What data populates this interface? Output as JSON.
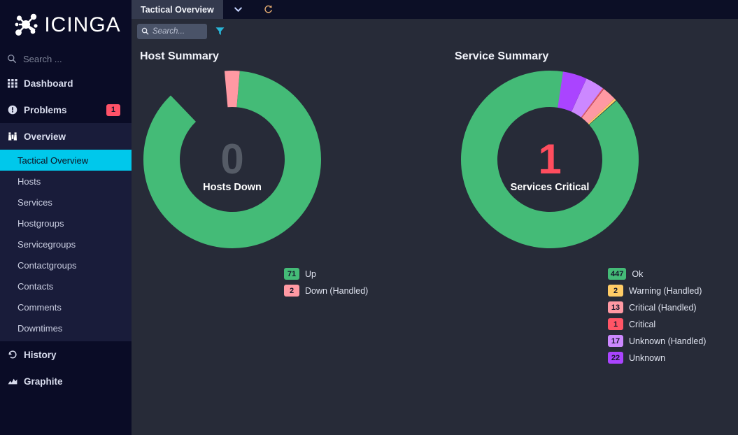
{
  "sidebar": {
    "brand": "ICINGA",
    "search_placeholder": "Search ...",
    "items": [
      {
        "label": "Dashboard",
        "icon": "grid-icon"
      },
      {
        "label": "Problems",
        "icon": "exclamation-circle-icon",
        "badge": "1"
      },
      {
        "label": "Overview",
        "icon": "binoculars-icon"
      }
    ],
    "submenu": [
      {
        "label": "Tactical Overview",
        "active": true
      },
      {
        "label": "Hosts",
        "active": false
      },
      {
        "label": "Services",
        "active": false
      },
      {
        "label": "Hostgroups",
        "active": false
      },
      {
        "label": "Servicegroups",
        "active": false
      },
      {
        "label": "Contactgroups",
        "active": false
      },
      {
        "label": "Contacts",
        "active": false
      },
      {
        "label": "Comments",
        "active": false
      },
      {
        "label": "Downtimes",
        "active": false
      }
    ],
    "footer_items": [
      {
        "label": "History",
        "icon": "history-icon"
      },
      {
        "label": "Graphite",
        "icon": "area-chart-icon"
      }
    ]
  },
  "tabbar": {
    "active_tab": "Tactical Overview",
    "dropdown_icon": "chevron-down-icon",
    "refresh_icon": "refresh-icon"
  },
  "toolbar": {
    "search_placeholder": "Search...",
    "search_value": "",
    "search_icon": "search-icon",
    "filter_icon": "filter-funnel-icon"
  },
  "colors": {
    "ok": "#44bb77",
    "warning": "#ffcc66",
    "critical": "#ff5566",
    "critical_handled": "#ff99a3",
    "unknown": "#aa44ff",
    "unknown_handled": "#cc88ff",
    "down_handled": "#ff99a3",
    "accent": "#00c8eb",
    "sidebar_bg": "#0a0c26",
    "content_bg": "#272b38"
  },
  "chart_data": [
    {
      "type": "pie",
      "title": "Host Summary",
      "center_number": "0",
      "center_label": "Hosts Down",
      "center_number_color": "#555b66",
      "categories": [
        "Up",
        "Down (Handled)"
      ],
      "values": [
        71,
        2
      ],
      "colors": [
        "#44bb77",
        "#ff99a3"
      ],
      "legend": [
        {
          "count": "71",
          "label": "Up",
          "color": "#44bb77"
        },
        {
          "count": "2",
          "label": "Down (Handled)",
          "color": "#ff99a3"
        }
      ],
      "legend_position": "bottom"
    },
    {
      "type": "pie",
      "title": "Service Summary",
      "center_number": "1",
      "center_label": "Services Critical",
      "center_number_color": "#ff4d5e",
      "categories": [
        "Ok",
        "Warning (Handled)",
        "Critical (Handled)",
        "Critical",
        "Unknown (Handled)",
        "Unknown"
      ],
      "values": [
        447,
        2,
        13,
        1,
        17,
        22
      ],
      "colors": [
        "#44bb77",
        "#ffcc66",
        "#ff99a3",
        "#ff5566",
        "#cc88ff",
        "#aa44ff"
      ],
      "legend": [
        {
          "count": "447",
          "label": "Ok",
          "color": "#44bb77"
        },
        {
          "count": "2",
          "label": "Warning (Handled)",
          "color": "#ffcc66"
        },
        {
          "count": "13",
          "label": "Critical (Handled)",
          "color": "#ff99a3"
        },
        {
          "count": "1",
          "label": "Critical",
          "color": "#ff5566"
        },
        {
          "count": "17",
          "label": "Unknown (Handled)",
          "color": "#cc88ff"
        },
        {
          "count": "22",
          "label": "Unknown",
          "color": "#aa44ff"
        }
      ],
      "legend_position": "bottom"
    }
  ]
}
